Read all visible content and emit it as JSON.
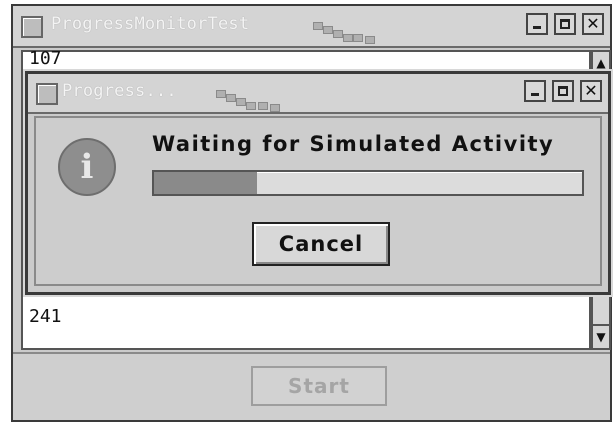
{
  "main_window": {
    "title": "ProgressMonitorTest",
    "list_lines": [
      "107",
      "241"
    ],
    "start_label": "Start"
  },
  "dialog": {
    "title": "Progress...",
    "message": "Waiting for Simulated Activity",
    "progress": 0.24,
    "cancel_label": "Cancel"
  },
  "window_controls": {
    "minimize_icon": "minimize-icon",
    "maximize_icon": "maximize-icon",
    "close_glyph": "✕"
  },
  "icons": {
    "info_glyph": "i"
  }
}
